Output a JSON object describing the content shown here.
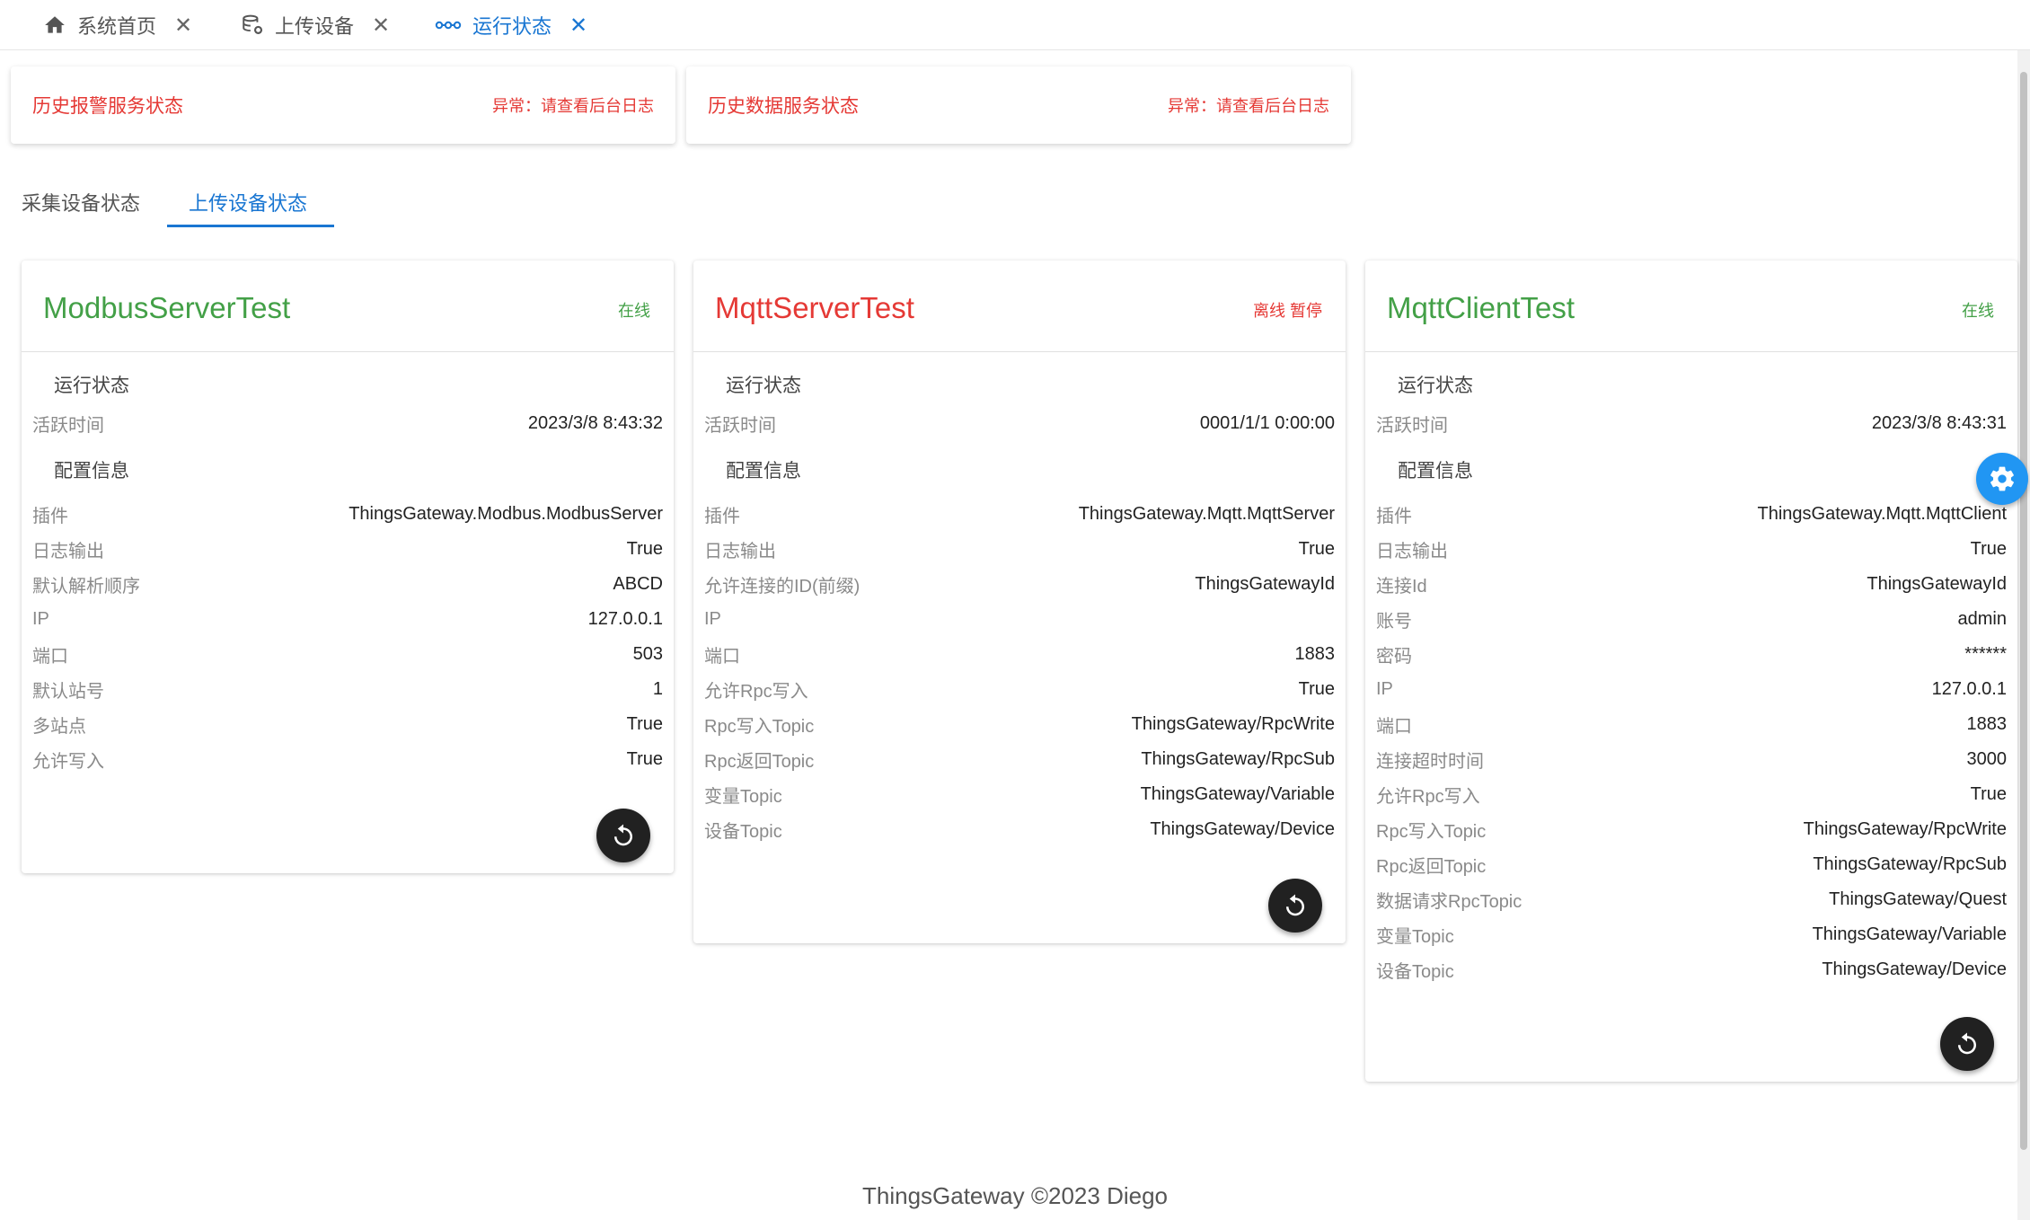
{
  "tabs": [
    {
      "label": "系统首页",
      "icon": "home-icon"
    },
    {
      "label": "上传设备",
      "icon": "database-settings-icon"
    },
    {
      "label": "运行状态",
      "icon": "dots-link-icon",
      "active": true
    }
  ],
  "services": [
    {
      "title": "历史报警服务状态",
      "status": "异常：请查看后台日志"
    },
    {
      "title": "历史数据服务状态",
      "status": "异常：请查看后台日志"
    }
  ],
  "inner_tabs": [
    {
      "label": "采集设备状态"
    },
    {
      "label": "上传设备状态",
      "active": true
    }
  ],
  "devices": [
    {
      "name": "ModbusServerTest",
      "status": "在线",
      "status_color": "#43a047",
      "run_section": "运行状态",
      "active_time_label": "活跃时间",
      "active_time": "2023/3/8 8:43:32",
      "config_section": "配置信息",
      "config": [
        {
          "k": "插件",
          "v": "ThingsGateway.Modbus.ModbusServer"
        },
        {
          "k": "日志输出",
          "v": "True"
        },
        {
          "k": "默认解析顺序",
          "v": "ABCD"
        },
        {
          "k": "IP",
          "v": "127.0.0.1"
        },
        {
          "k": "端口",
          "v": "503"
        },
        {
          "k": "默认站号",
          "v": "1"
        },
        {
          "k": "多站点",
          "v": "True"
        },
        {
          "k": "允许写入",
          "v": "True"
        }
      ]
    },
    {
      "name": "MqttServerTest",
      "status": "离线 暂停",
      "status_color": "#e53935",
      "run_section": "运行状态",
      "active_time_label": "活跃时间",
      "active_time": "0001/1/1 0:00:00",
      "config_section": "配置信息",
      "config": [
        {
          "k": "插件",
          "v": "ThingsGateway.Mqtt.MqttServer"
        },
        {
          "k": "日志输出",
          "v": "True"
        },
        {
          "k": "允许连接的ID(前缀)",
          "v": "ThingsGatewayId"
        },
        {
          "k": "IP",
          "v": ""
        },
        {
          "k": "端口",
          "v": "1883"
        },
        {
          "k": "允许Rpc写入",
          "v": "True"
        },
        {
          "k": "Rpc写入Topic",
          "v": "ThingsGateway/RpcWrite"
        },
        {
          "k": "Rpc返回Topic",
          "v": "ThingsGateway/RpcSub"
        },
        {
          "k": "变量Topic",
          "v": "ThingsGateway/Variable"
        },
        {
          "k": "设备Topic",
          "v": "ThingsGateway/Device"
        }
      ]
    },
    {
      "name": "MqttClientTest",
      "status": "在线",
      "status_color": "#43a047",
      "run_section": "运行状态",
      "active_time_label": "活跃时间",
      "active_time": "2023/3/8 8:43:31",
      "config_section": "配置信息",
      "config": [
        {
          "k": "插件",
          "v": "ThingsGateway.Mqtt.MqttClient"
        },
        {
          "k": "日志输出",
          "v": "True"
        },
        {
          "k": "连接Id",
          "v": "ThingsGatewayId"
        },
        {
          "k": "账号",
          "v": "admin"
        },
        {
          "k": "密码",
          "v": "******"
        },
        {
          "k": "IP",
          "v": "127.0.0.1"
        },
        {
          "k": "端口",
          "v": "1883"
        },
        {
          "k": "连接超时时间",
          "v": "3000"
        },
        {
          "k": "允许Rpc写入",
          "v": "True"
        },
        {
          "k": "Rpc写入Topic",
          "v": "ThingsGateway/RpcWrite"
        },
        {
          "k": "Rpc返回Topic",
          "v": "ThingsGateway/RpcSub"
        },
        {
          "k": "数据请求RpcTopic",
          "v": "ThingsGateway/Quest"
        },
        {
          "k": "变量Topic",
          "v": "ThingsGateway/Variable"
        },
        {
          "k": "设备Topic",
          "v": "ThingsGateway/Device"
        }
      ]
    }
  ],
  "restart_icon": "restart-icon",
  "settings_icon": "gear-icon",
  "footer": "ThingsGateway ©2023 Diego"
}
